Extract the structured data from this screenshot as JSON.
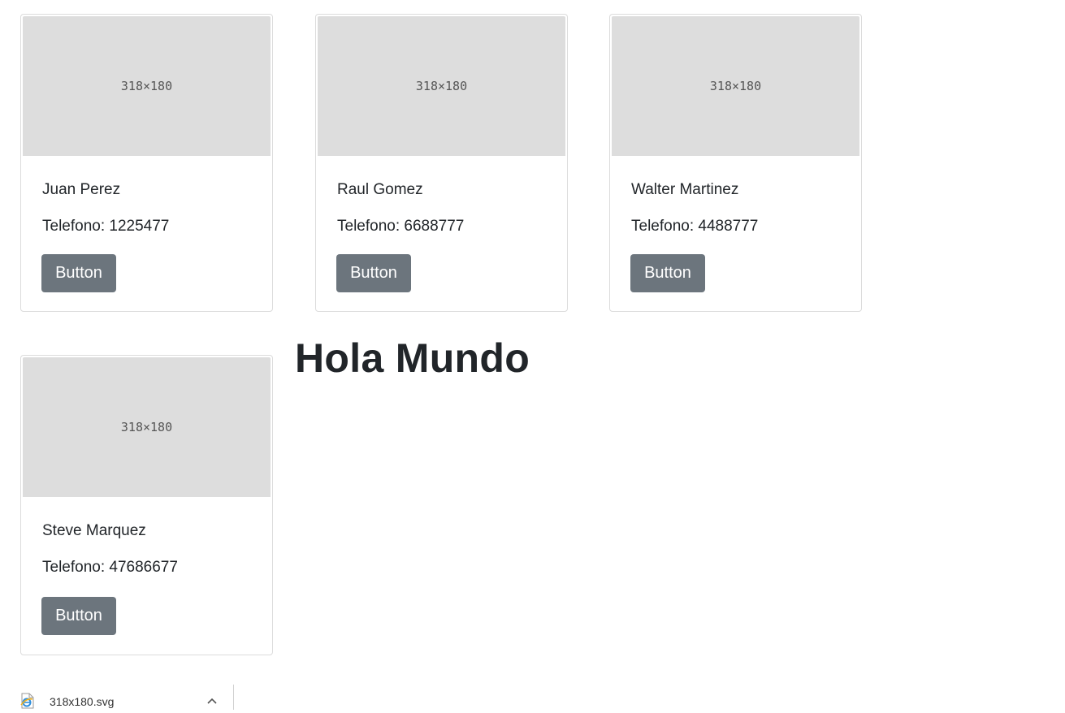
{
  "cards": [
    {
      "image_label": "318×180",
      "name": "Juan Perez",
      "phone": "Telefono: 1225477",
      "button_label": "Button"
    },
    {
      "image_label": "318×180",
      "name": "Raul Gomez",
      "phone": "Telefono: 6688777",
      "button_label": "Button"
    },
    {
      "image_label": "318×180",
      "name": "Walter Martinez",
      "phone": "Telefono: 4488777",
      "button_label": "Button"
    },
    {
      "image_label": "318×180",
      "name": "Steve Marquez",
      "phone": "Telefono: 47686677",
      "button_label": "Button"
    }
  ],
  "heading": "Hola Mundo",
  "download_bar": {
    "file_name": "318x180.svg",
    "file_icon": "internet-explorer-file-icon",
    "menu_icon": "chevron-up-icon"
  },
  "colors": {
    "button_bg": "#6c757d",
    "placeholder_bg": "#dddddd",
    "text": "#212529"
  }
}
